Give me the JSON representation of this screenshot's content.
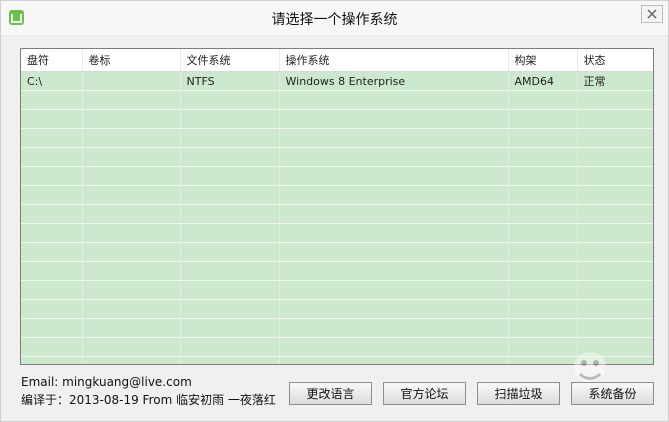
{
  "window": {
    "title": "请选择一个操作系统"
  },
  "table": {
    "columns": [
      "盘符",
      "卷标",
      "文件系统",
      "操作系统",
      "构架",
      "状态"
    ],
    "rows": [
      [
        "C:\\",
        "",
        "NTFS",
        "Windows 8 Enterprise",
        "AMD64",
        "正常"
      ]
    ]
  },
  "footer": {
    "email": "Email: mingkuang@live.com",
    "compile": "编译于：2013-08-19 From 临安初雨 一夜落红"
  },
  "buttons": {
    "change_language": "更改语言",
    "official_forum": "官方论坛",
    "scan_junk": "扫描垃圾",
    "system_backup": "系统备份"
  },
  "icons": {
    "app": "app-icon",
    "close": "close-icon"
  }
}
